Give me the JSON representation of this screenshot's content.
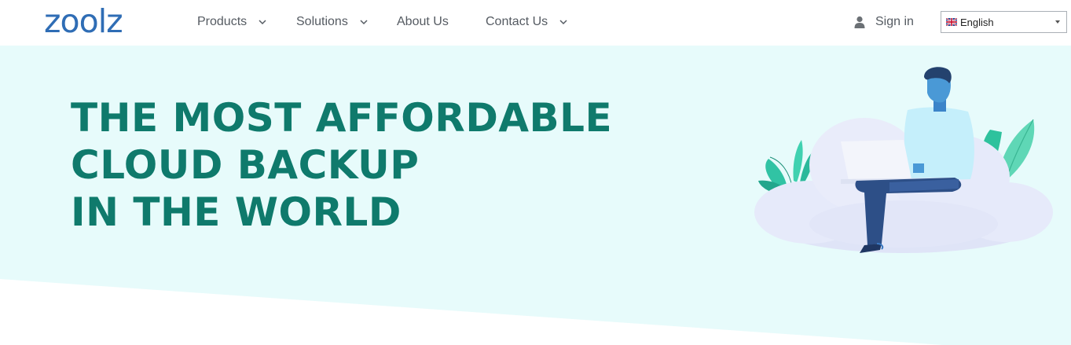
{
  "header": {
    "logo_text": "zoolz",
    "nav": [
      {
        "label": "Products",
        "has_dropdown": true
      },
      {
        "label": "Solutions",
        "has_dropdown": true
      },
      {
        "label": "About Us",
        "has_dropdown": false
      },
      {
        "label": "Contact Us",
        "has_dropdown": true
      }
    ],
    "signin_label": "Sign in",
    "language": {
      "selected": "English",
      "flag_icon": "uk-flag-icon"
    }
  },
  "hero": {
    "headline_lines": [
      "THE MOST AFFORDABLE",
      "CLOUD BACKUP",
      "IN THE WORLD"
    ]
  },
  "colors": {
    "logo": "#2f6db5",
    "headline": "#0f7a6c",
    "hero_background": "#e7fbfb",
    "nav_text": "#555b62"
  }
}
